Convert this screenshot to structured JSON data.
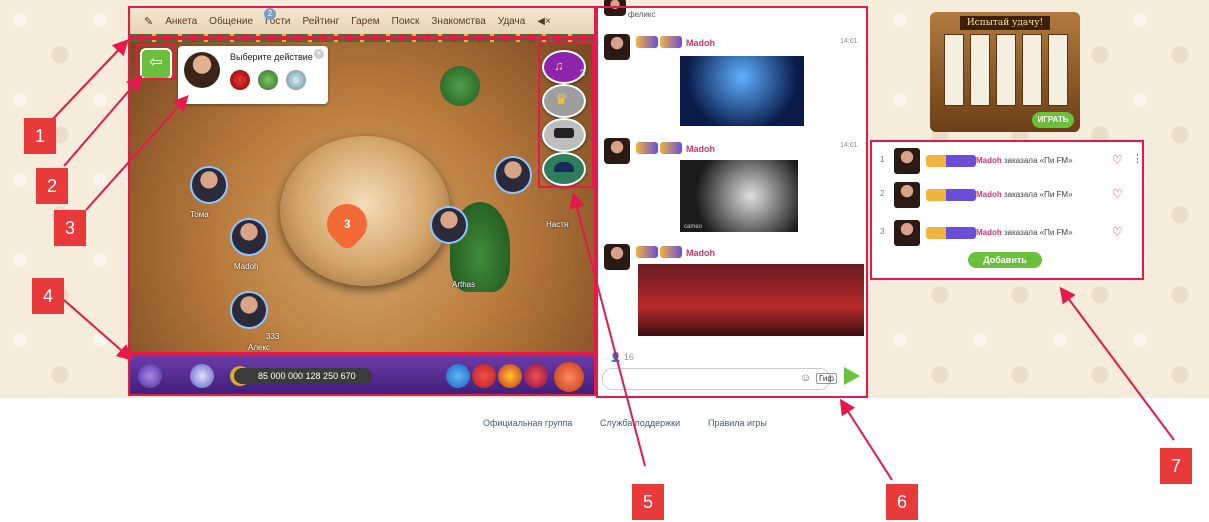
{
  "nav": {
    "items": [
      "Анкета",
      "Общение",
      "Гости",
      "Рейтинг",
      "Гарем",
      "Поиск",
      "Знакомства",
      "Удача"
    ],
    "guests_badge": "2"
  },
  "action_popup": {
    "title": "Выберите действие"
  },
  "game": {
    "heart_count": "3",
    "music_count": "3",
    "players": [
      "Тома",
      "Madoh",
      "Алекс",
      "Настя",
      "Arthas",
      "333"
    ],
    "money": "85 000 000 128 250 670"
  },
  "chat": {
    "top_user": "феликс",
    "messages": [
      {
        "name": "Madoh",
        "time": "14:01"
      },
      {
        "name": "Madoh",
        "time": "14:01"
      },
      {
        "name": "Madoh",
        "time": ""
      }
    ],
    "gif_caption": "cameo",
    "online_count": "16",
    "gif_button": "Гиф"
  },
  "slot": {
    "title": "Испытай удачу!",
    "play_label": "ИГРАТЬ"
  },
  "orders": {
    "rows": [
      {
        "num": "1",
        "name": "Madoh",
        "text": "заказала «Пи FM»"
      },
      {
        "num": "2",
        "name": "Madoh",
        "text": "заказала «Пи FM»"
      },
      {
        "num": "3",
        "name": "Madoh",
        "text": "заказала «Пи FM»"
      }
    ],
    "add_label": "Добавить"
  },
  "footer": {
    "links": [
      "Официальная группа",
      "Служба поддержки",
      "Правила игры"
    ]
  },
  "annotations": [
    "1",
    "2",
    "3",
    "4",
    "5",
    "6",
    "7"
  ],
  "colors": {
    "highlight": "#e6194b",
    "tag": "#e83a3a",
    "accent_green": "#6cbf3b",
    "name_pink": "#d6336c"
  }
}
